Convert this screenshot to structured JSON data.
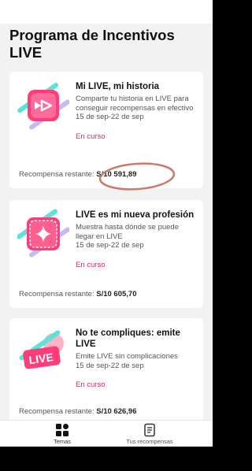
{
  "page": {
    "title": "Programa de Incentivos LIVE"
  },
  "cards": [
    {
      "title": "Mi LIVE, mi historia",
      "description": "Comparte tu historia en LIVE para conseguir recompensas en efectivo",
      "dates": "15 de sep-22 de sep",
      "status": "En curso",
      "reward_label": "Recompensa restante:",
      "reward_amount": "S/10 591,89",
      "icon": "video-play-icon"
    },
    {
      "title": "LIVE es mi nueva profesión",
      "description": "Muestra hasta dónde se puede llegar en LIVE",
      "dates": "15 de sep-22 de sep",
      "status": "En curso",
      "reward_label": "Recompensa restante:",
      "reward_amount": "S/10 605,70",
      "icon": "sparkle-icon"
    },
    {
      "title": "No te compliques: emite LIVE",
      "description": "Emite LIVE sin complicaciones",
      "dates": "15 de sep-22 de sep",
      "status": "En curso",
      "reward_label": "Recompensa restante:",
      "reward_amount": "S/10 626,96",
      "icon": "live-badge-icon",
      "badge_text": "LIVE"
    }
  ],
  "tabbar": {
    "temas": "Temas",
    "recompensas": "Tus recompensas"
  },
  "colors": {
    "accent": "#e0245e",
    "background": "#f2f2f3",
    "annotation": "#c97b6b"
  }
}
